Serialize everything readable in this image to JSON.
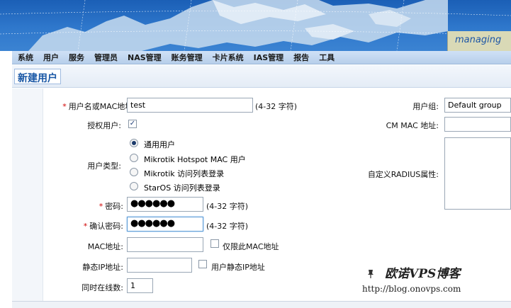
{
  "banner": {
    "tagline": "managing"
  },
  "menu": [
    "系统",
    "用户",
    "服务",
    "管理员",
    "NAS管理",
    "账务管理",
    "卡片系统",
    "IAS管理",
    "报告",
    "工具"
  ],
  "page": {
    "title": "新建用户"
  },
  "form": {
    "username": {
      "label": "用户名或MAC地址:",
      "value": "test",
      "hint": "(4-32 字符)"
    },
    "authorized": {
      "label": "授权用户:",
      "checked": true,
      "mark": "✓"
    },
    "user_type": {
      "label": "用户类型:",
      "options": [
        "通用用户",
        "Mikrotik Hotspot MAC 用户",
        "Mikrotik 访问列表登录",
        "StarOS 访问列表登录"
      ],
      "selected": 0
    },
    "password": {
      "label": "密码:",
      "value": "●●●●●●",
      "hint": "(4-32 字符)"
    },
    "confirm_password": {
      "label": "确认密码:",
      "value": "●●●●●●",
      "hint": "(4-32 字符)"
    },
    "mac": {
      "label": "MAC地址:",
      "value": "",
      "check_label": "仅限此MAC地址"
    },
    "static_ip": {
      "label": "静态IP地址:",
      "value": "",
      "check_label": "用户静态IP地址"
    },
    "simultaneous": {
      "label": "同时在线数:",
      "value": "1"
    },
    "user_group": {
      "label": "用户组:",
      "value": "Default group"
    },
    "cm_mac": {
      "label": "CM MAC 地址:",
      "value": ""
    },
    "radius_attrs": {
      "label": "自定义RADIUS属性:",
      "value": ""
    }
  },
  "watermark": {
    "title": "欧诺VPS博客",
    "url": "http://blog.onovps.com"
  },
  "colors": {
    "banner": "#2f78cc",
    "menubar": "#c4d8ef",
    "title": "#1a58a6",
    "required": "#d00000"
  }
}
